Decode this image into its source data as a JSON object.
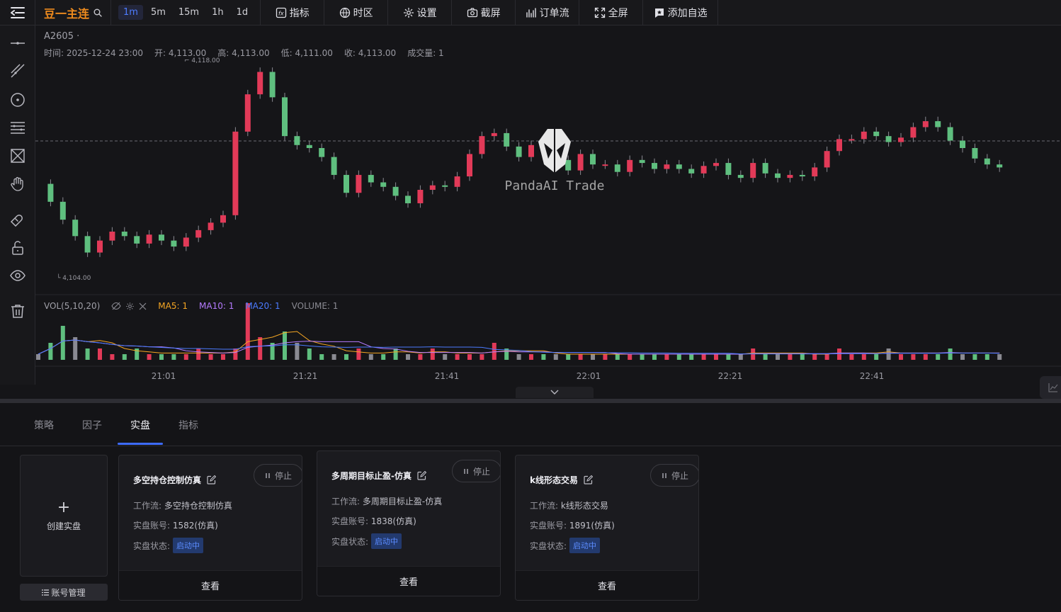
{
  "toolbar": {
    "symbol_name": "豆一主连",
    "intervals": [
      "1m",
      "5m",
      "15m",
      "1h",
      "1d"
    ],
    "active_interval": "1m",
    "tools": {
      "indicator": "指标",
      "timezone": "时区",
      "settings": "设置",
      "screenshot": "截屏",
      "orderflow": "订单流",
      "fullscreen": "全屏",
      "watchlist": "添加自选"
    }
  },
  "chart": {
    "title": "A2605 ·",
    "ohlc": {
      "time": "时间: 2025-12-24 23:00",
      "open": "开: 4,113.00",
      "high": "高: 4,113.00",
      "low": "低: 4,111.00",
      "close": "收: 4,113.00",
      "volume": "成交量: 1"
    },
    "max_label": "4,118.00",
    "min_label": "4,104.00",
    "watermark": "PandaAI Trade",
    "vol_legend": {
      "name": "VOL(5,10,20)",
      "ma5": "MA5: 1",
      "ma10": "MA10: 1",
      "ma20": "MA20: 1",
      "volume": "VOLUME: 1"
    },
    "time_labels": [
      "21:01",
      "21:21",
      "21:41",
      "22:01",
      "22:21",
      "22:41"
    ],
    "up_color": "#e23a58",
    "down_color": "#5fbf7f"
  },
  "chart_data": {
    "type": "candlestick",
    "symbol": "A2605",
    "interval": "1m",
    "price_range": [
      4104,
      4118
    ],
    "price_series": [
      4110.0,
      4108.8,
      4107.6,
      4106.5,
      4105.4,
      4106.2,
      4106.8,
      4106.5,
      4106.0,
      4106.6,
      4106.2,
      4105.8,
      4106.4,
      4106.9,
      4107.4,
      4107.9,
      4113.5,
      4116.0,
      4117.5,
      4115.8,
      4113.2,
      4112.6,
      4112.4,
      4111.8,
      4110.6,
      4109.4,
      4110.6,
      4110.1,
      4109.8,
      4109.2,
      4108.7,
      4109.6,
      4109.9,
      4109.8,
      4110.5,
      4112.0,
      4113.2,
      4113.4,
      4112.5,
      4111.8,
      4112.6,
      4112.4,
      4111.6,
      4110.9,
      4112.0,
      4111.3,
      4111.3,
      4110.8,
      4111.6,
      4111.4,
      4111.0,
      4111.3,
      4111.0,
      4110.7,
      4111.2,
      4111.4,
      4110.6,
      4110.4,
      4111.4,
      4110.7,
      4110.4,
      4110.6,
      4110.5,
      4111.1,
      4112.2,
      4113.0,
      4113.0,
      4113.5,
      4113.2,
      4112.8,
      4113.1,
      4113.8,
      4114.2,
      4113.8,
      4112.9,
      4112.4,
      4111.7,
      4111.3,
      4111.1
    ],
    "volume_series": [
      1,
      3,
      6,
      4,
      2,
      2,
      1,
      1,
      2,
      1,
      1,
      1,
      1,
      2,
      1,
      1,
      2,
      10,
      4,
      3,
      5,
      3,
      2,
      1,
      1,
      1,
      2,
      1,
      1,
      2,
      1,
      1,
      2,
      1,
      1,
      1,
      1,
      3,
      2,
      1,
      1,
      1,
      1,
      1,
      1,
      1,
      1,
      1,
      1,
      1,
      1,
      1,
      1,
      1,
      1,
      1,
      1,
      1,
      2,
      1,
      1,
      1,
      1,
      1,
      1,
      2,
      1,
      1,
      1,
      2,
      1,
      1,
      1,
      1,
      2,
      1,
      1,
      1,
      1
    ],
    "x_ticks": [
      "21:01",
      "21:21",
      "21:41",
      "22:01",
      "22:21",
      "22:41"
    ]
  },
  "bottom": {
    "tabs": [
      "策略",
      "因子",
      "实盘",
      "指标"
    ],
    "active_tab": "实盘",
    "create_label": "创建实盘",
    "create_plus": "+",
    "account_btn": "账号管理",
    "cards": [
      {
        "title": "多空持仓控制仿真",
        "stop": "停止",
        "workflow_label": "工作流:",
        "workflow": "多空持仓控制仿真",
        "account_label": "实盘账号:",
        "account": "1582(仿真)",
        "status_label": "实盘状态:",
        "status": "启动中",
        "view": "查看"
      },
      {
        "title": "多周期目标止盈-仿真",
        "stop": "停止",
        "workflow_label": "工作流:",
        "workflow": "多周期目标止盈-仿真",
        "account_label": "实盘账号:",
        "account": "1838(仿真)",
        "status_label": "实盘状态:",
        "status": "启动中",
        "view": "查看"
      },
      {
        "title": "k线形态交易",
        "stop": "停止",
        "workflow_label": "工作流:",
        "workflow": "k线形态交易",
        "account_label": "实盘账号:",
        "account": "1891(仿真)",
        "status_label": "实盘状态:",
        "status": "启动中",
        "view": "查看"
      }
    ]
  }
}
